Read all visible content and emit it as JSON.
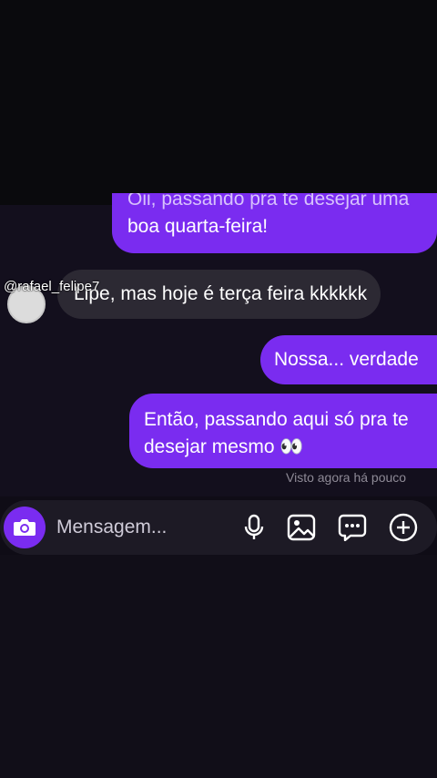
{
  "header": {
    "sender_handle": "@rafael_felipe7"
  },
  "messages": [
    {
      "id": "m1",
      "direction": "out",
      "clipped_line": "Oii, passando pra te desejar uma",
      "text": "boa quarta-feira!"
    },
    {
      "id": "m2",
      "direction": "in",
      "text": "Lipe, mas hoje é terça feira kkkkkk"
    },
    {
      "id": "m3",
      "direction": "out",
      "text": "Nossa... verdade"
    },
    {
      "id": "m4",
      "direction": "out",
      "text": "Então, passando aqui só pra te desejar mesmo 👀"
    }
  ],
  "seen_status": "Visto agora há pouco",
  "composer": {
    "placeholder": "Mensagem..."
  },
  "icons": {
    "camera": "camera-icon",
    "mic": "microphone-icon",
    "gallery": "image-icon",
    "sticker": "chat-bubble-icon",
    "plus": "plus-circle-icon"
  },
  "colors": {
    "accent": "#7a2cf0",
    "incoming_bubble": "#2c2933",
    "background": "#130f1d"
  }
}
